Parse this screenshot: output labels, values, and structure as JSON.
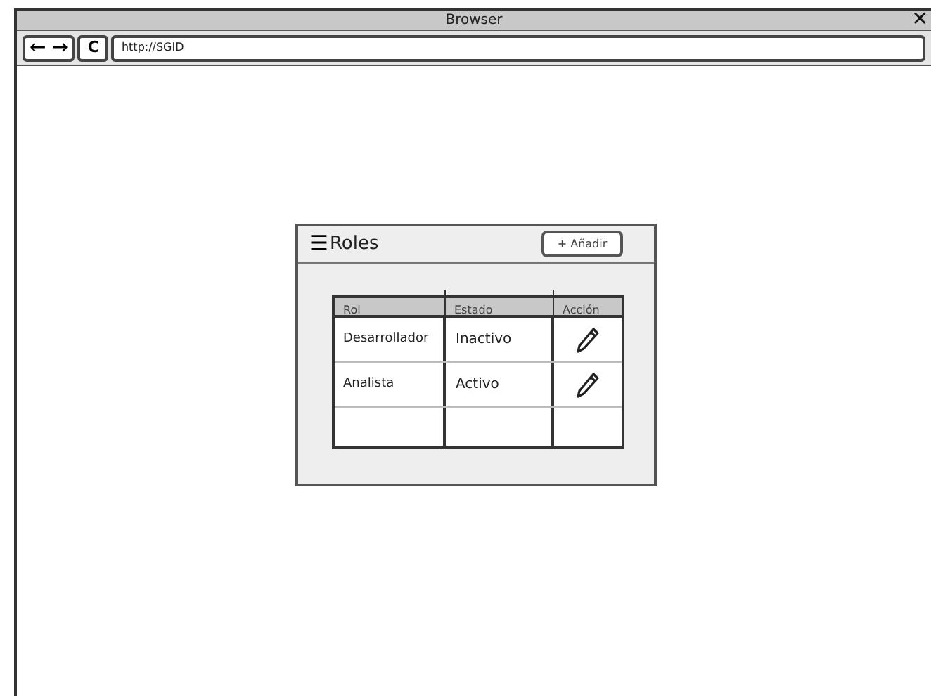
{
  "window": {
    "title": "Browser",
    "close": "✕"
  },
  "nav": {
    "back": "←",
    "forward": "→",
    "reload": "C",
    "url": "http://SGID"
  },
  "panel": {
    "menu": "☰",
    "title": "Roles",
    "add_button": "+ Añadir",
    "table": {
      "columns": [
        "Rol",
        "Estado",
        "Acción"
      ],
      "rows": [
        {
          "rol": "Desarrollador",
          "estado": "Inactivo"
        },
        {
          "rol": "Analista",
          "estado": "Activo"
        }
      ]
    }
  }
}
